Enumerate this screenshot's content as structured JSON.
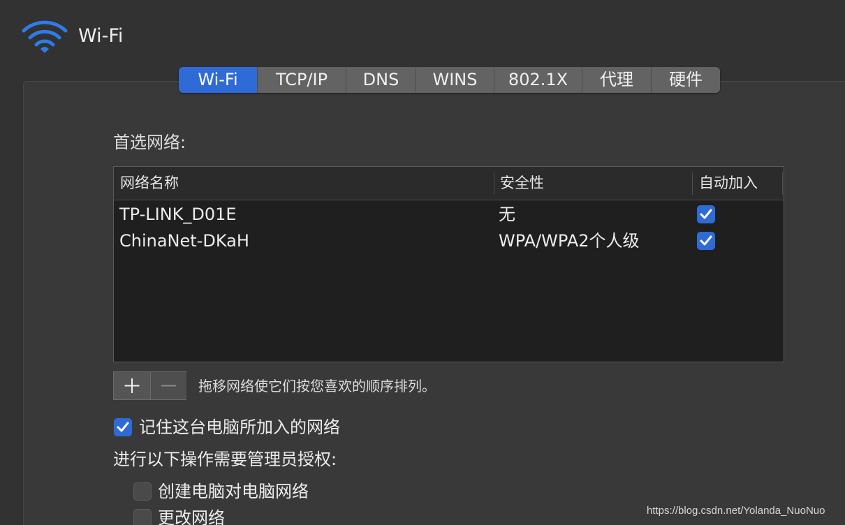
{
  "header": {
    "title": "Wi-Fi",
    "icon": "wifi-icon",
    "accent": "#2f6bd6"
  },
  "tabs": [
    {
      "label": "Wi-Fi",
      "active": true
    },
    {
      "label": "TCP/IP",
      "active": false
    },
    {
      "label": "DNS",
      "active": false
    },
    {
      "label": "WINS",
      "active": false
    },
    {
      "label": "802.1X",
      "active": false
    },
    {
      "label": "代理",
      "active": false
    },
    {
      "label": "硬件",
      "active": false
    }
  ],
  "preferred": {
    "label": "首选网络:",
    "columns": {
      "name": "网络名称",
      "security": "安全性",
      "auto_join": "自动加入"
    },
    "rows": [
      {
        "name": "TP-LINK_D01E",
        "security": "无",
        "auto_join": true
      },
      {
        "name": "ChinaNet-DKaH",
        "security": "WPA/WPA2个人级",
        "auto_join": true
      }
    ],
    "hint": "拖移网络使它们按您喜欢的顺序排列。"
  },
  "options": {
    "remember": {
      "label": "记住这台电脑所加入的网络",
      "checked": true
    },
    "admin_label": "进行以下操作需要管理员授权:",
    "create": {
      "label": "创建电脑对电脑网络",
      "checked": false
    },
    "change": {
      "label": "更改网络",
      "checked": false
    }
  },
  "watermark": "https://blog.csdn.net/Yolanda_NuoNuo"
}
